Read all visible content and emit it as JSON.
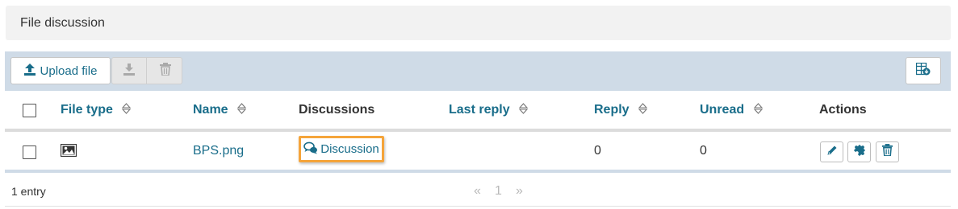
{
  "panel": {
    "title": "File discussion"
  },
  "toolbar": {
    "upload_label": "Upload file"
  },
  "table": {
    "columns": {
      "file_type": "File type",
      "name": "Name",
      "discussions": "Discussions",
      "last_reply": "Last reply",
      "reply": "Reply",
      "unread": "Unread",
      "actions": "Actions"
    },
    "rows": [
      {
        "file_type_icon": "image-icon",
        "name": "BPS.png",
        "discussion_label": "Discussion",
        "last_reply": "",
        "reply": "0",
        "unread": "0"
      }
    ]
  },
  "footer": {
    "entries": "1 entry",
    "prev": "«",
    "page": "1",
    "next": "»"
  },
  "colors": {
    "link": "#196d8a",
    "toolbar_bg": "#cfdbe7",
    "highlight": "#f5a43a"
  }
}
